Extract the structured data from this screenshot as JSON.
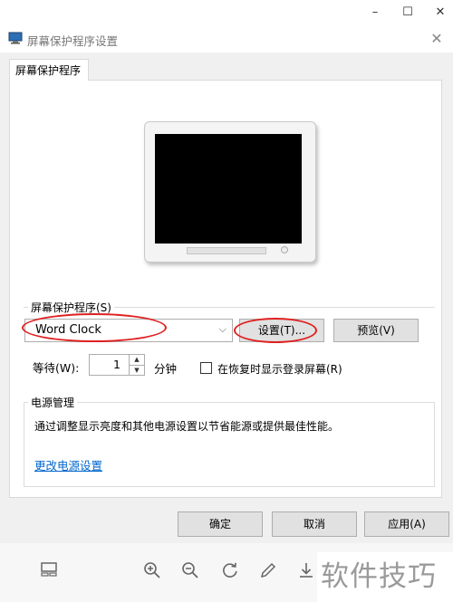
{
  "outer_window": {
    "minimize_glyph": "–",
    "maximize_glyph": "☐",
    "close_glyph": "✕"
  },
  "dialog": {
    "title": "屏幕保护程序设置",
    "close_glyph": "✕",
    "tab_label": "屏幕保护程序"
  },
  "screensaver": {
    "group_label": "屏幕保护程序(S)",
    "selected": "Word Clock",
    "settings_button": "设置(T)...",
    "preview_button": "预览(V)",
    "wait_label": "等待(W):",
    "wait_value": "1",
    "wait_unit": "分钟",
    "resume_checkbox_label": "在恢复时显示登录屏幕(R)",
    "resume_checked": false
  },
  "power": {
    "group_label": "电源管理",
    "description": "通过调整显示亮度和其他电源设置以节省能源或提供最佳性能。",
    "link": "更改电源设置"
  },
  "buttons": {
    "ok": "确定",
    "cancel": "取消",
    "apply": "应用(A)"
  },
  "viewer_toolbar": {
    "icons": [
      "layout-icon",
      "zoom-in-icon",
      "zoom-out-icon",
      "rotate-icon",
      "edit-icon",
      "download-icon"
    ]
  },
  "watermark": "软件技巧",
  "colors": {
    "link": "#0066cc",
    "annotation": "#e02020"
  }
}
